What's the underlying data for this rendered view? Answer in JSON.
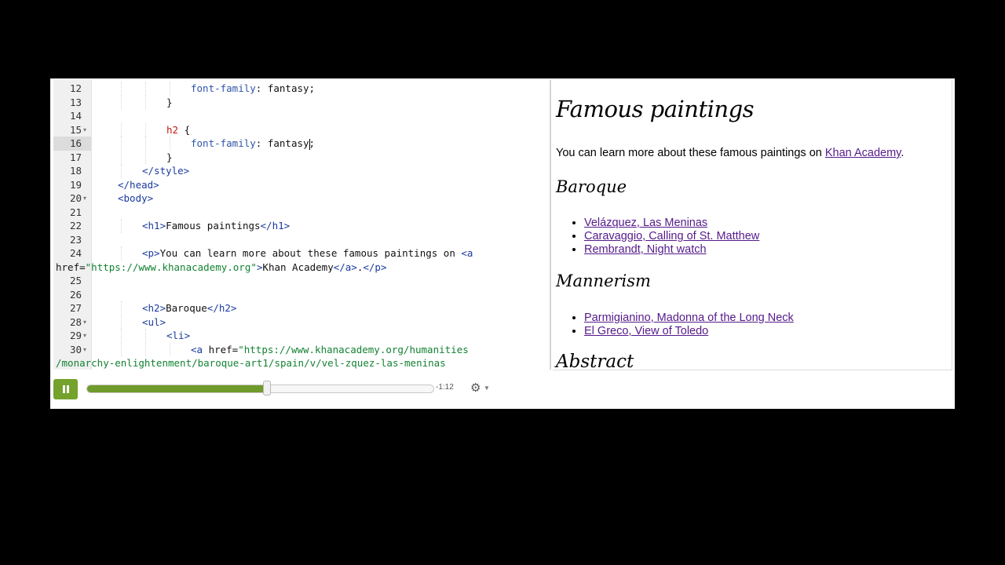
{
  "editor": {
    "active_line": "16",
    "lines": [
      {
        "num": "12",
        "fold": false,
        "indent": 4,
        "tokens": [
          {
            "t": "font-family",
            "c": "prop"
          },
          {
            "t": ": fantasy;",
            "c": "plain"
          }
        ]
      },
      {
        "num": "13",
        "fold": false,
        "indent": 3,
        "tokens": [
          {
            "t": "}",
            "c": "plain"
          }
        ]
      },
      {
        "num": "14",
        "fold": false,
        "indent": 0,
        "tokens": []
      },
      {
        "num": "15",
        "fold": true,
        "indent": 3,
        "tokens": [
          {
            "t": "h2",
            "c": "sel"
          },
          {
            "t": " {",
            "c": "plain"
          }
        ]
      },
      {
        "num": "16",
        "fold": false,
        "indent": 4,
        "tokens": [
          {
            "t": "font-family",
            "c": "prop"
          },
          {
            "t": ": fantasy",
            "c": "plain"
          },
          {
            "t": "|",
            "c": "cursor"
          },
          {
            "t": ";",
            "c": "plain"
          }
        ]
      },
      {
        "num": "17",
        "fold": false,
        "indent": 3,
        "tokens": [
          {
            "t": "}",
            "c": "plain"
          }
        ]
      },
      {
        "num": "18",
        "fold": false,
        "indent": 2,
        "tokens": [
          {
            "t": "</style>",
            "c": "tag"
          }
        ]
      },
      {
        "num": "19",
        "fold": false,
        "indent": 1,
        "tokens": [
          {
            "t": "</head>",
            "c": "tag"
          }
        ]
      },
      {
        "num": "20",
        "fold": true,
        "indent": 1,
        "tokens": [
          {
            "t": "<body>",
            "c": "tag"
          }
        ]
      },
      {
        "num": "21",
        "fold": false,
        "indent": 0,
        "tokens": []
      },
      {
        "num": "22",
        "fold": false,
        "indent": 2,
        "tokens": [
          {
            "t": "<h1>",
            "c": "tag"
          },
          {
            "t": "Famous paintings",
            "c": "plain"
          },
          {
            "t": "</h1>",
            "c": "tag"
          }
        ]
      },
      {
        "num": "23",
        "fold": false,
        "indent": 0,
        "tokens": []
      },
      {
        "num": "24",
        "fold": false,
        "indent": 2,
        "tokens": [
          {
            "t": "<p>",
            "c": "tag"
          },
          {
            "t": "You can learn more about these famous paintings on ",
            "c": "plain"
          },
          {
            "t": "<a",
            "c": "tag"
          }
        ]
      },
      {
        "num": "",
        "fold": false,
        "indent": -1,
        "tokens": [
          {
            "t": "href=",
            "c": "plain"
          },
          {
            "t": "\"https://www.khanacademy.org\"",
            "c": "str"
          },
          {
            "t": ">",
            "c": "tag"
          },
          {
            "t": "Khan Academy",
            "c": "plain"
          },
          {
            "t": "</a>",
            "c": "tag"
          },
          {
            "t": ".",
            "c": "plain"
          },
          {
            "t": "</p>",
            "c": "tag"
          }
        ]
      },
      {
        "num": "25",
        "fold": false,
        "indent": 0,
        "tokens": []
      },
      {
        "num": "26",
        "fold": false,
        "indent": 0,
        "tokens": []
      },
      {
        "num": "27",
        "fold": false,
        "indent": 2,
        "tokens": [
          {
            "t": "<h2>",
            "c": "tag"
          },
          {
            "t": "Baroque",
            "c": "plain"
          },
          {
            "t": "</h2>",
            "c": "tag"
          }
        ]
      },
      {
        "num": "28",
        "fold": true,
        "indent": 2,
        "tokens": [
          {
            "t": "<ul>",
            "c": "tag"
          }
        ]
      },
      {
        "num": "29",
        "fold": true,
        "indent": 3,
        "tokens": [
          {
            "t": "<li>",
            "c": "tag"
          }
        ]
      },
      {
        "num": "30",
        "fold": true,
        "indent": 4,
        "tokens": [
          {
            "t": "<a ",
            "c": "tag"
          },
          {
            "t": "href=",
            "c": "plain"
          },
          {
            "t": "\"https://www.khanacademy.org/humanities",
            "c": "str"
          }
        ]
      },
      {
        "num": "",
        "fold": false,
        "indent": -1,
        "tokens": [
          {
            "t": "/monarchy-enlightenment/baroque-art1/spain/v/vel-zquez-las-meninas",
            "c": "str"
          }
        ]
      }
    ]
  },
  "preview": {
    "h1": "Famous paintings",
    "intro_text": "You can learn more about these famous paintings on ",
    "intro_link": "Khan Academy",
    "intro_end": ".",
    "sections": [
      {
        "title": "Baroque",
        "items": [
          "Velázquez, Las Meninas",
          "Caravaggio, Calling of St. Matthew",
          "Rembrandt, Night watch"
        ]
      },
      {
        "title": "Mannerism",
        "items": [
          "Parmigianino, Madonna of the Long Neck",
          "El Greco, View of Toledo"
        ]
      },
      {
        "title": "Abstract",
        "items": []
      }
    ]
  },
  "player": {
    "state": "playing",
    "progress": 0.52,
    "time_remaining": "-1:12",
    "accent_color": "#74a22c",
    "settings_icon": "gear-icon"
  }
}
